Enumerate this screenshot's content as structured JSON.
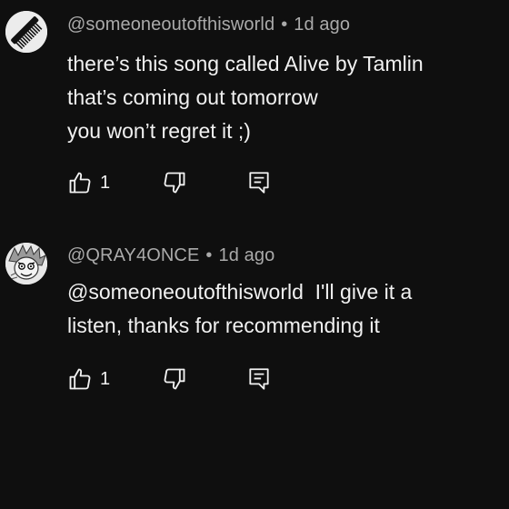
{
  "comments": [
    {
      "author": "@someoneoutofthisworld",
      "separator": "•",
      "time": "1d ago",
      "lines": [
        "there’s this song called Alive by Tamlin",
        "that’s coming out tomorrow",
        "you won’t regret it ;)"
      ],
      "like_count": "1",
      "avatar_icon": "comb-icon"
    },
    {
      "author": "@QRAY4ONCE",
      "separator": "•",
      "time": "1d ago",
      "lines": [
        "@someoneoutofthisworld  I'll give it a",
        "listen, thanks for recommending it"
      ],
      "like_count": "1",
      "avatar_icon": "manga-character-icon"
    }
  ],
  "colors": {
    "background": "#0f0f0f",
    "text": "#f1f1f1",
    "secondary_text": "#aaaaaa"
  }
}
